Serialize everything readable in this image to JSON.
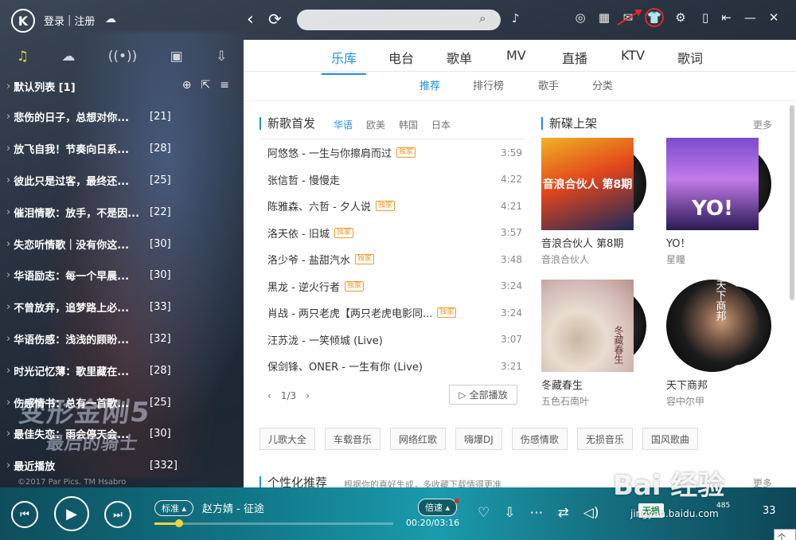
{
  "topbar": {
    "logo": "K",
    "login": "登录",
    "register": "注册",
    "search_placeholder": ""
  },
  "left_tabs": [
    {
      "icon": "music-note-icon",
      "glyph": "♫"
    },
    {
      "icon": "cloud-icon",
      "glyph": "☁"
    },
    {
      "icon": "radio-icon",
      "glyph": "◉"
    },
    {
      "icon": "device-icon",
      "glyph": "▣"
    },
    {
      "icon": "download-icon",
      "glyph": "⇩"
    }
  ],
  "playlist_header": "默认列表 [1]",
  "playlists": [
    {
      "title": "悲伤的日子，总想对你...",
      "count": "[21]"
    },
    {
      "title": "放飞自我！节奏向日系...",
      "count": "[28]"
    },
    {
      "title": "彼此只是过客，最终还...",
      "count": "[25]"
    },
    {
      "title": "催泪情歌：放手，不是因...",
      "count": "[22]"
    },
    {
      "title": "失恋听情歌｜没有你这...",
      "count": "[30]"
    },
    {
      "title": "华语励志：每一个早晨...",
      "count": "[30]"
    },
    {
      "title": "不曾放弃，追梦路上必...",
      "count": "[33]"
    },
    {
      "title": "华语伤感：浅浅的顾盼...",
      "count": "[32]"
    },
    {
      "title": "时光记忆薄：歌里藏在...",
      "count": "[28]"
    },
    {
      "title": "伤感情书：总有一首歌...",
      "count": "[25]"
    },
    {
      "title": "最佳失恋：雨会停天会...",
      "count": "[30]"
    },
    {
      "title": "最近播放",
      "count": "[332]"
    }
  ],
  "background": {
    "watermark_line1": "变形金刚5",
    "watermark_line2": "最后的骑士",
    "copyright": "©2017 Par Pics. TM Hsabro"
  },
  "main_tabs": [
    "乐库",
    "电台",
    "歌单",
    "MV",
    "直播",
    "KTV",
    "歌词"
  ],
  "sub_tabs": [
    "推荐",
    "排行榜",
    "歌手",
    "分类"
  ],
  "new_songs": {
    "title": "新歌首发",
    "languages": [
      "华语",
      "欧美",
      "韩国",
      "日本"
    ],
    "songs": [
      {
        "title": "阿悠悠 - 一生与你擦肩而过",
        "badge": "独家",
        "duration": "3:59"
      },
      {
        "title": "张信哲 - 慢慢走",
        "badge": "",
        "duration": "4:22"
      },
      {
        "title": "陈雅森、六哲 - 夕人说",
        "badge": "独家",
        "duration": "4:21"
      },
      {
        "title": "洛天依 - 旧城",
        "badge": "独家",
        "duration": "3:57"
      },
      {
        "title": "洛少爷 - 盐甜汽水",
        "badge": "独家",
        "duration": "3:48"
      },
      {
        "title": "黑龙 - 逆火行者",
        "badge": "独家",
        "duration": "3:24"
      },
      {
        "title": "肖战 - 两只老虎【两只老虎电影同...",
        "badge": "独家",
        "duration": "3:24"
      },
      {
        "title": "汪苏泷 - 一笑倾城 (Live)",
        "badge": "",
        "duration": "3:07"
      },
      {
        "title": "保剑锋、ONER - 一生有你 (Live)",
        "badge": "",
        "duration": "3:21"
      }
    ],
    "pager": "1/3",
    "play_all": "全部播放"
  },
  "new_albums": {
    "title": "新碟上架",
    "more": "更多",
    "albums": [
      {
        "title": "音浪合伙人 第8期",
        "artist": "音浪合伙人",
        "cover_text": "音浪合伙人 第8期"
      },
      {
        "title": "YO！",
        "artist": "星瞳",
        "cover_text": "YO!"
      },
      {
        "title": "冬藏春生",
        "artist": "五色石南叶",
        "cover_text": "冬藏春生"
      },
      {
        "title": "天下商邦",
        "artist": "容中尔甲",
        "cover_text": "天下商邦"
      }
    ]
  },
  "tags": [
    "儿歌大全",
    "车载音乐",
    "网络红歌",
    "嗨爆DJ",
    "伤感情歌",
    "无损音乐",
    "国风歌曲"
  ],
  "personal": {
    "title": "个性化推荐",
    "desc": "根据你的喜好生成，多收藏下载情得更准",
    "more": "更多"
  },
  "player": {
    "quality": "标准",
    "now_playing": "赵方婧 - 征途",
    "speed": "倍速",
    "time": "00:20/03:16",
    "progress": 0.104,
    "lossless": "无损",
    "listeners": "485",
    "extra": "33"
  },
  "overlay": {
    "baidu": "Bai 经验",
    "url": "jingyan.baidu.com",
    "tip": "个性"
  },
  "colors": {
    "accent": "#1e8fe0",
    "badge": "#f29a2e",
    "highlight": "#e02828",
    "player_bg": "#107586"
  }
}
